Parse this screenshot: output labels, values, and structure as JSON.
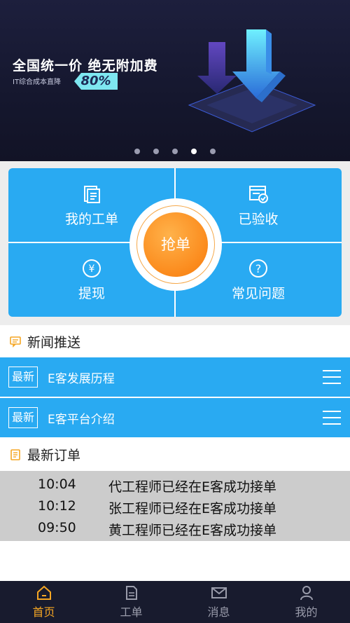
{
  "banner": {
    "headline": "全国统一价  绝无附加费",
    "subline": "IT综合成本直降",
    "badge": "80%",
    "slide_count": 5,
    "active_slide": 4
  },
  "grid": {
    "my_orders": "我的工单",
    "accepted": "已验收",
    "withdraw": "提现",
    "faq": "常见问题",
    "grab": "抢单"
  },
  "news": {
    "title": "新闻推送",
    "items": [
      {
        "tag": "最新",
        "title": "E客发展历程"
      },
      {
        "tag": "最新",
        "title": "E客平台介绍"
      }
    ]
  },
  "orders": {
    "title": "最新订单",
    "rows": [
      {
        "time": "10:04",
        "text": "代工程师已经在E客成功接单"
      },
      {
        "time": "10:12",
        "text": "张工程师已经在E客成功接单"
      },
      {
        "time": "09:50",
        "text": "黄工程师已经在E客成功接单"
      }
    ]
  },
  "tabbar": {
    "items": [
      {
        "label": "首页",
        "icon": "home-icon"
      },
      {
        "label": "工单",
        "icon": "document-icon"
      },
      {
        "label": "消息",
        "icon": "mail-icon"
      },
      {
        "label": "我的",
        "icon": "user-icon"
      }
    ],
    "active_index": 0
  },
  "colors": {
    "accent_blue": "#29aaf2",
    "accent_orange": "#f5a623",
    "tabbar_bg": "#181b2e"
  }
}
